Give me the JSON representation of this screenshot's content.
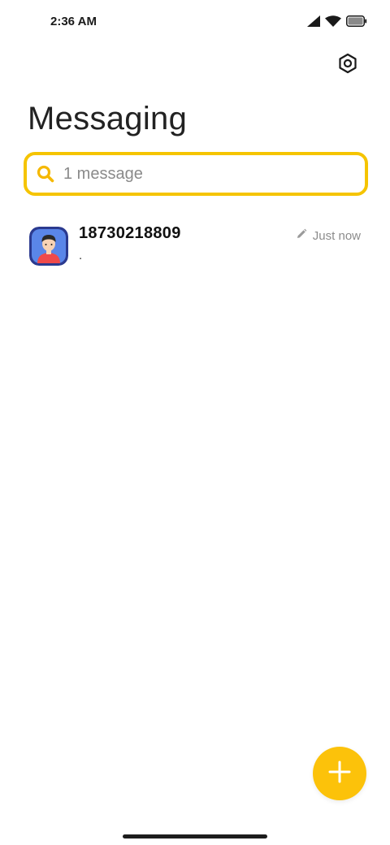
{
  "status_bar": {
    "time": "2:36 AM"
  },
  "header": {
    "title": "Messaging",
    "settings_icon": "gear-icon"
  },
  "search": {
    "placeholder": "1 message",
    "value": "",
    "accent_color": "#f5c400"
  },
  "conversations": [
    {
      "name": "18730218809",
      "snippet": ".",
      "time": "Just now",
      "status_icon": "pencil-icon",
      "avatar": "person-avatar"
    }
  ],
  "fab": {
    "icon": "plus-icon",
    "color": "#fcc20a"
  }
}
